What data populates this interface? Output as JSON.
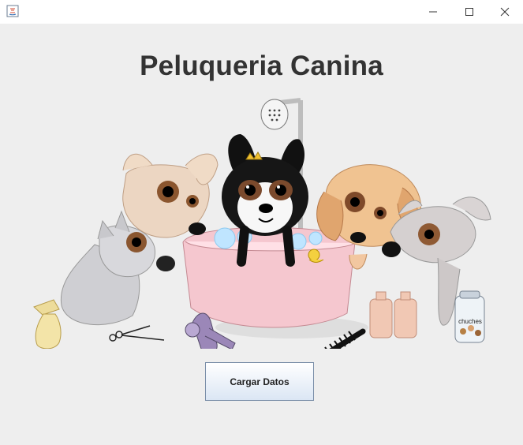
{
  "window": {
    "icon": "java-app-icon",
    "controls": [
      "minimize-icon",
      "maximize-icon",
      "close-icon"
    ]
  },
  "main": {
    "title": "Peluqueria Canina",
    "button_label": "Cargar Datos",
    "illustration_label": "chuches"
  },
  "colors": {
    "background": "#eeeeee",
    "title": "#333333",
    "button_border": "#7a8ea8"
  }
}
